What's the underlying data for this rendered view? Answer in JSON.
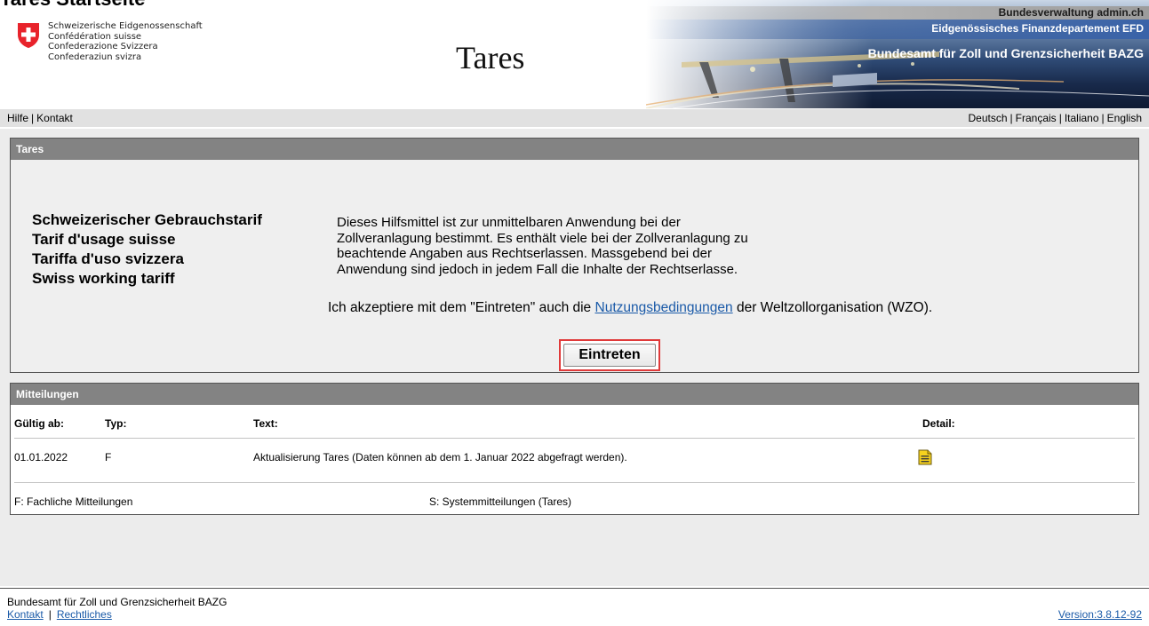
{
  "page": {
    "heading": "Tares Startseite"
  },
  "header": {
    "confederation_lines": [
      "Schweizerische Eidgenossenschaft",
      "Confédération suisse",
      "Confederazione Svizzera",
      "Confederaziun svizra"
    ],
    "app_title": "Tares",
    "banner_top": "Bundesverwaltung admin.ch",
    "banner_department": "Eidgenössisches Finanzdepartement EFD",
    "banner_office": "Bundesamt für Zoll und Grenzsicherheit BAZG"
  },
  "nav": {
    "left_links": [
      "Hilfe",
      "Kontakt"
    ],
    "languages": [
      "Deutsch",
      "Français",
      "Italiano",
      "English"
    ]
  },
  "tares_panel": {
    "header": "Tares",
    "tariff_names": [
      "Schweizerischer Gebrauchstarif",
      "Tarif d'usage suisse",
      "Tariffa d'uso svizzera",
      "Swiss working tariff"
    ],
    "description_lines": [
      "Dieses Hilfsmittel ist zur unmittelbaren Anwendung bei der",
      "Zollveranlagung bestimmt. Es enthält viele bei der Zollveranlagung zu",
      "beachtende Angaben aus Rechtserlassen. Massgebend bei der",
      "Anwendung sind jedoch in jedem Fall die Inhalte der Rechtserlasse."
    ],
    "accept_prefix": "Ich akzeptiere mit dem \"Eintreten\" auch die ",
    "accept_link": "Nutzungsbedingungen",
    "accept_suffix": " der Weltzollorganisation (WZO).",
    "enter_button": "Eintreten"
  },
  "messages_panel": {
    "header": "Mitteilungen",
    "columns": [
      "Gültig ab:",
      "Typ:",
      "Text:",
      "Detail:"
    ],
    "rows": [
      {
        "valid_from": "01.01.2022",
        "type": "F",
        "text": "Aktualisierung Tares (Daten können ab dem 1. Januar 2022 abgefragt werden).",
        "detail_icon": "document-icon"
      }
    ],
    "legend_f": "F: Fachliche Mitteilungen",
    "legend_s": "S: Systemmitteilungen (Tares)"
  },
  "footer": {
    "organization": "Bundesamt für Zoll und Grenzsicherheit BAZG",
    "links": [
      "Kontakt",
      "Rechtliches"
    ],
    "version": "Version:3.8.12-92"
  },
  "colors": {
    "panel_header_bg": "#838383",
    "nav_bg": "#e1e1e1",
    "highlight_border": "#e03a3a",
    "link": "#1a5aa8",
    "swiss_red": "#e8232b"
  }
}
